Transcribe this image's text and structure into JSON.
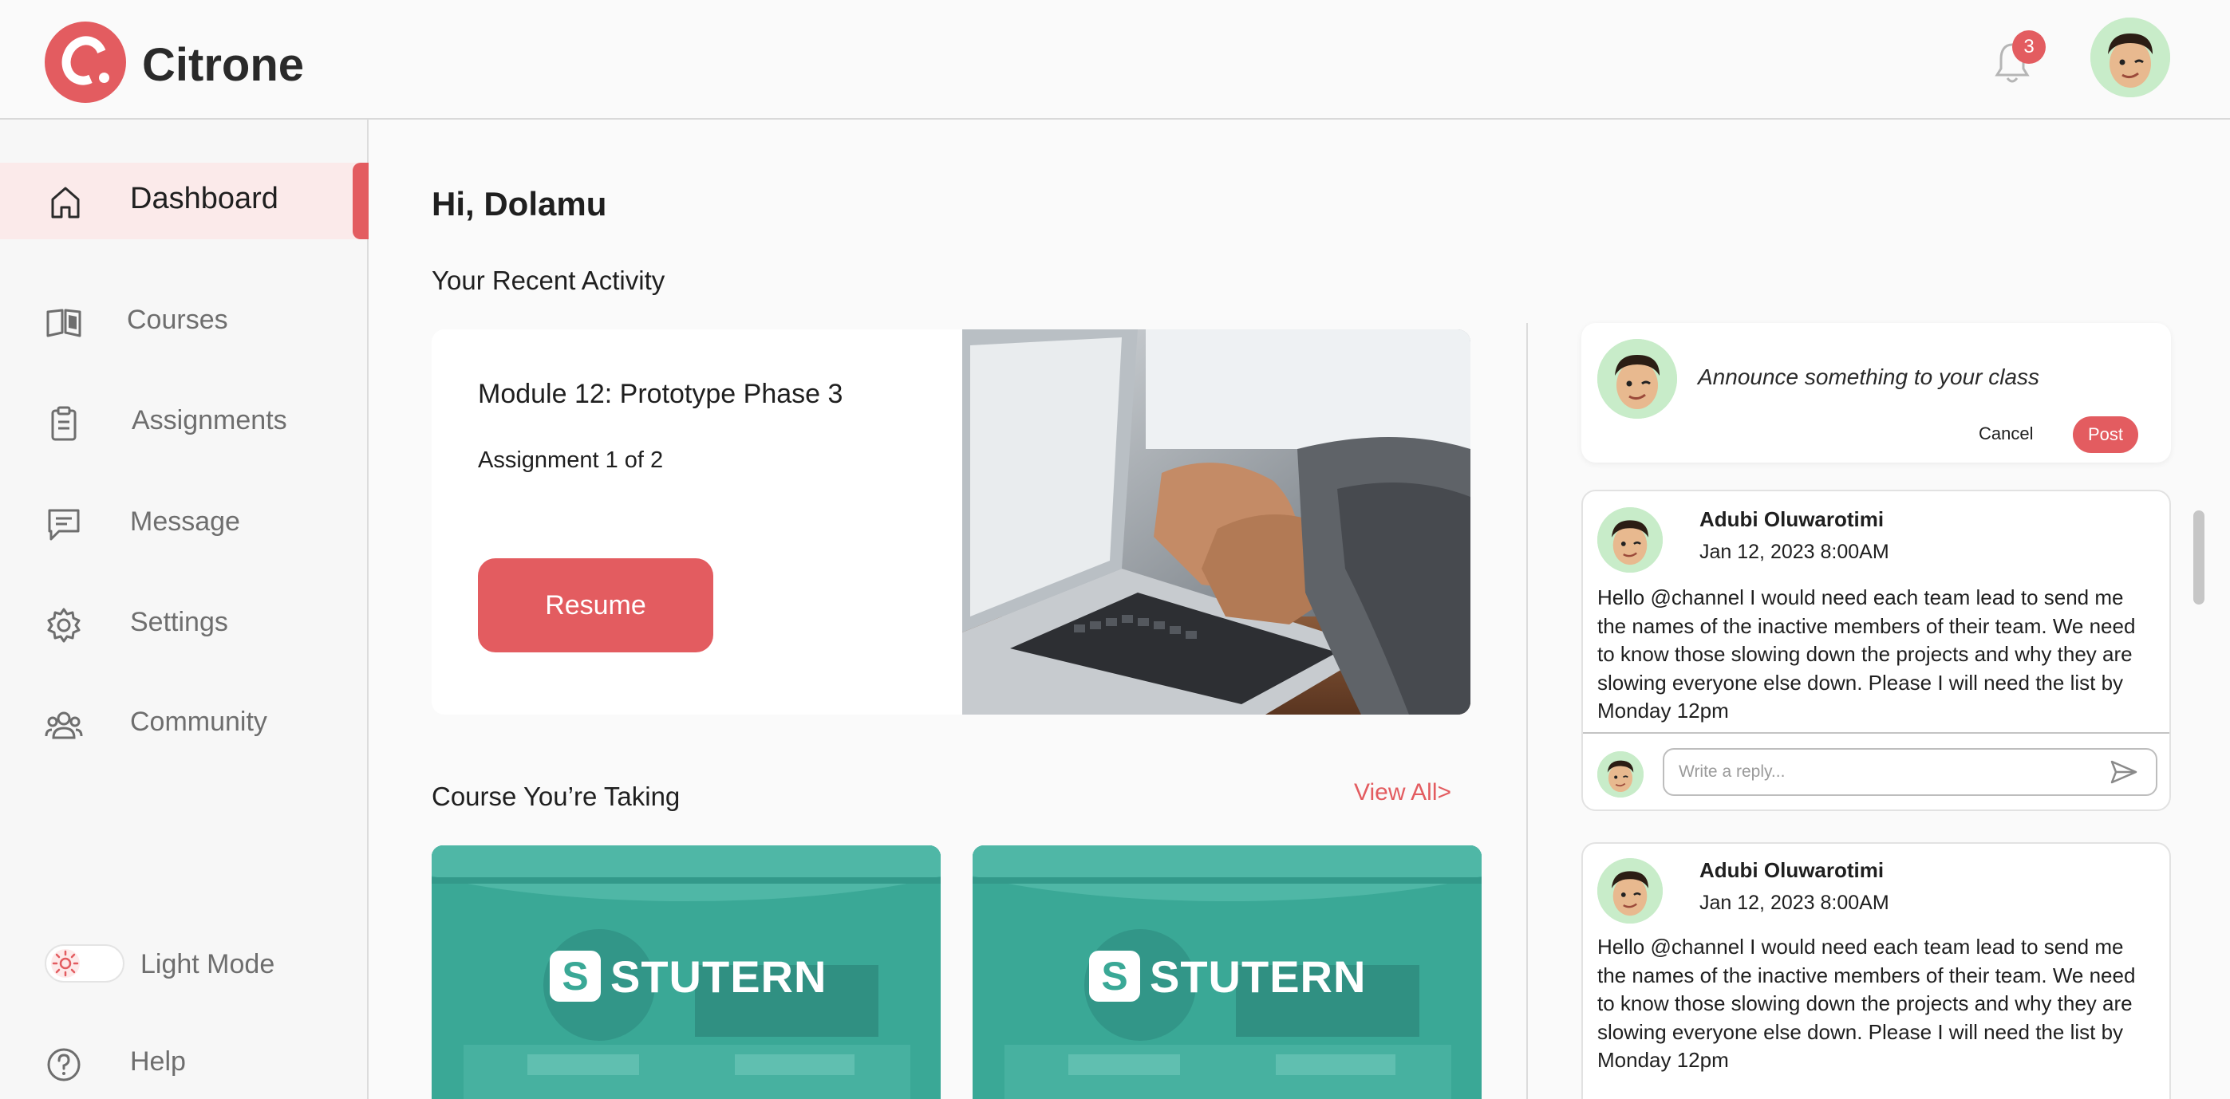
{
  "header": {
    "brand": "Citrone",
    "notification_count": "3"
  },
  "sidebar": {
    "items": [
      {
        "label": "Dashboard",
        "icon": "home-icon"
      },
      {
        "label": "Courses",
        "icon": "book-icon"
      },
      {
        "label": "Assignments",
        "icon": "clipboard-icon"
      },
      {
        "label": "Message",
        "icon": "message-icon"
      },
      {
        "label": "Settings",
        "icon": "gear-icon"
      },
      {
        "label": "Community",
        "icon": "users-icon"
      }
    ],
    "light_mode_label": "Light Mode",
    "help_label": "Help"
  },
  "main": {
    "greeting": "Hi, Dolamu",
    "recent_activity_title": "Your Recent Activity",
    "activity": {
      "module_title": "Module 12: Prototype Phase 3",
      "assignment_progress": "Assignment 1 of 2",
      "resume_label": "Resume"
    },
    "courses_title": "Course You’re Taking",
    "view_all_label": "View All>",
    "courses": [
      {
        "brand": "STUTERN",
        "mark": "S"
      },
      {
        "brand": "STUTERN",
        "mark": "S"
      }
    ]
  },
  "feed": {
    "announce_placeholder": "Announce something to your class",
    "cancel_label": "Cancel",
    "post_label": "Post",
    "reply_placeholder": "Write a reply...",
    "posts": [
      {
        "author": "Adubi Oluwarotimi",
        "date": "Jan 12, 2023  8:00AM",
        "body": "Hello @channel I would need each team lead to send me the names of the inactive members of their team. We need to know those slowing down the projects and why they are slowing everyone else down. Please I will need the list by Monday 12pm"
      },
      {
        "author": "Adubi Oluwarotimi",
        "date": "Jan 12, 2023  8:00AM",
        "body": "Hello @channel I would need each team lead to send me the names of the inactive members of their team. We need to know those slowing down the projects and why they are slowing everyone else down. Please I will need the list by Monday 12pm"
      }
    ]
  },
  "colors": {
    "accent": "#e35c60",
    "active_nav_bg": "#fbeaea",
    "course_teal": "#3aa896",
    "avatar_bg": "#c8ecc9"
  }
}
